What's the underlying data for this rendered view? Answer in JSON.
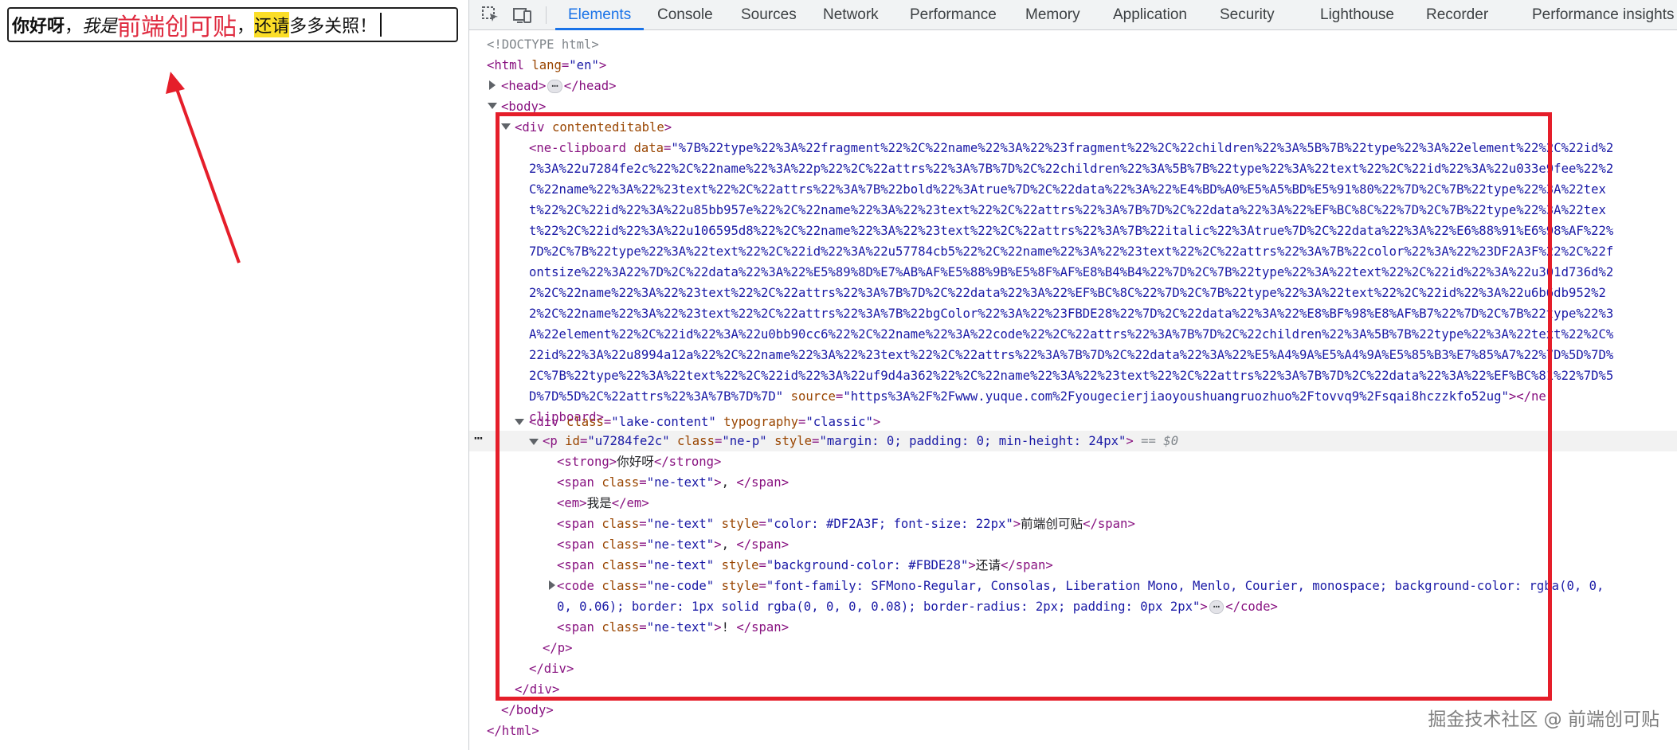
{
  "editor": {
    "strong": "你好呀",
    "comma1": "，",
    "em": "我是",
    "colored": "前端创可贴",
    "comma2": "，",
    "highlighted": "还请",
    "code": "多多关照",
    "exclaim": "！",
    "colored_color": "#DF2A3F",
    "highlight_color": "#FBDE28"
  },
  "devtools": {
    "tabs": [
      "Elements",
      "Console",
      "Sources",
      "Network",
      "Performance",
      "Memory",
      "Application",
      "Security",
      "Lighthouse",
      "Recorder",
      "Performance insights"
    ],
    "active_tab": "Elements",
    "icons": [
      "inspect-element-icon",
      "device-toolbar-icon"
    ],
    "accent_color": "#1a73e8"
  },
  "dom": {
    "doctype": "<!DOCTYPE html>",
    "html_open": "<html",
    "html_lang_attr": " lang",
    "html_lang_val": "\"en\"",
    "head_open": "<head>",
    "head_close": "</head>",
    "body_open": "<body>",
    "div_open": "<div",
    "div_attr": " contenteditable",
    "clip_open": "<ne-clipboard",
    "clip_data_attr": " data",
    "clip_data_lines": [
      "\"%7B%22type%22%3A%22fragment%22%2C%22name%22%3A%22%23fragment%22%2C%22children%22%3A%5B%7B%22type%22%3A%22element%22%2C%22id%2",
      "2%3A%22u7284fe2c%22%2C%22name%22%3A%22p%22%2C%22attrs%22%3A%7B%7D%2C%22children%22%3A%5B%7B%22type%22%3A%22text%22%2C%22id%22%3A%22u033e9fee%22%2",
      "C%22name%22%3A%22%23text%22%2C%22attrs%22%3A%7B%22bold%22%3Atrue%7D%2C%22data%22%3A%22%E4%BD%A0%E5%A5%BD%E5%91%80%22%7D%2C%7B%22type%22%3A%22tex",
      "t%22%2C%22id%22%3A%22u85bb957e%22%2C%22name%22%3A%22%23text%22%2C%22attrs%22%3A%7B%7D%2C%22data%22%3A%22%EF%BC%8C%22%7D%2C%7B%22type%22%3A%22tex",
      "t%22%2C%22id%22%3A%22u106595d8%22%2C%22name%22%3A%22%23text%22%2C%22attrs%22%3A%7B%22italic%22%3Atrue%7D%2C%22data%22%3A%22%E6%88%91%E6%98%AF%22%",
      "7D%2C%7B%22type%22%3A%22text%22%2C%22id%22%3A%22u57784cb5%22%2C%22name%22%3A%22%23text%22%2C%22attrs%22%3A%7B%22color%22%3A%22%23DF2A3F%22%2C%22f",
      "ontsize%22%3A22%7D%2C%22data%22%3A%22%E5%89%8D%E7%AB%AF%E5%88%9B%E5%8F%AF%E8%B4%B4%22%7D%2C%7B%22type%22%3A%22text%22%2C%22id%22%3A%22u301d736d%2",
      "2%2C%22name%22%3A%22%23text%22%2C%22attrs%22%3A%7B%7D%2C%22data%22%3A%22%EF%BC%8C%22%7D%2C%7B%22type%22%3A%22text%22%2C%22id%22%3A%22u6b6db952%2",
      "2%2C%22name%22%3A%22%23text%22%2C%22attrs%22%3A%7B%22bgColor%22%3A%22%23FBDE28%22%7D%2C%22data%22%3A%22%E8%BF%98%E8%AF%B7%22%7D%2C%7B%22type%22%3",
      "A%22element%22%2C%22id%22%3A%22u0bb90cc6%22%2C%22name%22%3A%22code%22%2C%22attrs%22%3A%7B%7D%2C%22children%22%3A%5B%7B%22type%22%3A%22text%22%2C%",
      "22id%22%3A%22u8994a12a%22%2C%22name%22%3A%22%23text%22%2C%22attrs%22%3A%7B%7D%2C%22data%22%3A%22%E5%A4%9A%E5%A4%9A%E5%85%B3%E7%85%A7%22%7D%5D%7D%",
      "2C%7B%22type%22%3A%22text%22%2C%22id%22%3A%22uf9d4a362%22%2C%22name%22%3A%22%23text%22%2C%22attrs%22%3A%7B%7D%2C%22data%22%3A%22%EF%BC%81%22%7D%5",
      "D%7D%5D%2C%22attrs%22%3A%7B%7D%7D\""
    ],
    "clip_source_attr": " source",
    "clip_source_val": "\"https%3A%2F%2Fwww.yuque.com%2Fyougecierjiaoyoushuangruozhuo%2Ftovvq9%2Fsqai8hczzkfo52ug\"",
    "clip_close_a": "></ne-",
    "clip_close_b": "clipboard>",
    "lake_open": "<div",
    "lake_class_attr": " class",
    "lake_class_val": "\"lake-content\"",
    "lake_typo_attr": " typography",
    "lake_typo_val": "\"classic\"",
    "p_open": "<p",
    "p_id_attr": " id",
    "p_id_val": "\"u7284fe2c\"",
    "p_class_attr": " class",
    "p_class_val": "\"ne-p\"",
    "p_style_attr": " style",
    "p_style_val": "\"margin: 0; padding: 0; min-height: 24px\"",
    "p_eq": " == $0",
    "strong_line": "你好呀",
    "span1_val": "\"ne-text\"",
    "span1_text": ", ",
    "em_text": "我是",
    "span2_style": "\"color: #DF2A3F; font-size: 22px\"",
    "span2_text": "前端创可贴",
    "span3_text": ", ",
    "span4_style": "\"background-color: #FBDE28\"",
    "span4_text": "还请",
    "code_class": "\"ne-code\"",
    "code_style_a": "\"font-family: SFMono-Regular, Consolas, Liberation Mono, Menlo, Courier, monospace; background-color: rgba(0, 0,",
    "code_style_b": "0, 0.06); border: 1px solid rgba(0, 0, 0, 0.08); border-radius: 2px; padding: 0px 2px\"",
    "span5_text": "! ",
    "p_close": "</p>",
    "div_close": "</div>",
    "div_close2": "</div>",
    "body_close": "</body>",
    "html_close": "</html>"
  },
  "watermark": "掘金技术社区 @ 前端创可贴"
}
